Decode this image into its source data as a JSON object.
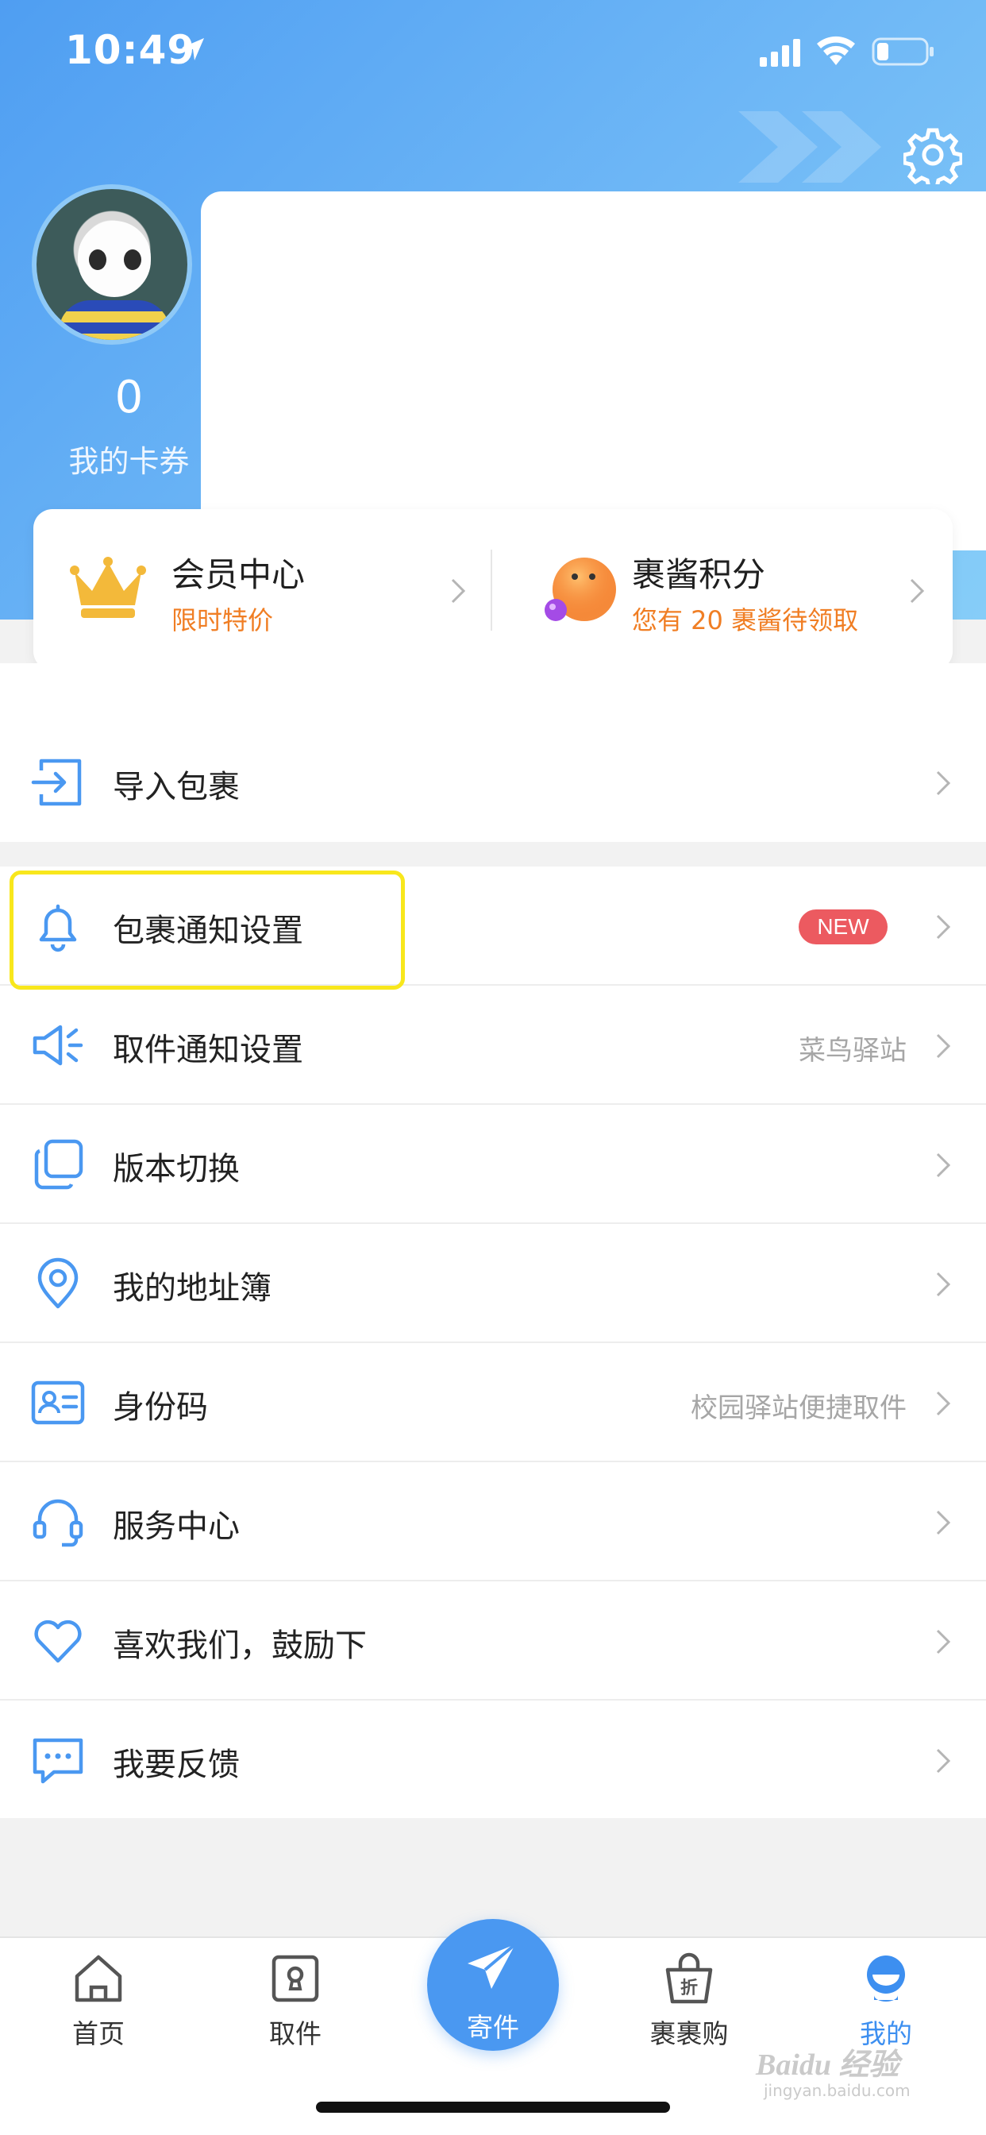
{
  "status_bar": {
    "time": "10:49"
  },
  "profile": {
    "coupon_count": "0",
    "coupon_label": "我的卡券"
  },
  "member_card": {
    "vip_title": "会员中心",
    "vip_subtitle": "限时特价",
    "points_title": "裹酱积分",
    "points_subtitle": "您有 20 裹酱待领取"
  },
  "menu": {
    "import": {
      "label": "导入包裹"
    },
    "items": [
      {
        "label": "包裹通知设置",
        "badge": "NEW",
        "right": ""
      },
      {
        "label": "取件通知设置",
        "right": "菜鸟驿站"
      },
      {
        "label": "版本切换",
        "right": ""
      },
      {
        "label": "我的地址簿",
        "right": ""
      },
      {
        "label": "身份码",
        "right": "校园驿站便捷取件"
      },
      {
        "label": "服务中心",
        "right": ""
      },
      {
        "label": "喜欢我们，鼓励下",
        "right": ""
      },
      {
        "label": "我要反馈",
        "right": ""
      }
    ]
  },
  "tabs": {
    "home": "首页",
    "pickup": "取件",
    "send": "寄件",
    "shop": "裹裹购",
    "mine": "我的"
  },
  "watermark": {
    "text": "Baidu 经验",
    "sub": "jingyan.baidu.com"
  },
  "colors": {
    "accent": "#4a98f1",
    "orange": "#f07e24",
    "badge": "#ec5a60",
    "highlight": "#f8e71c"
  }
}
